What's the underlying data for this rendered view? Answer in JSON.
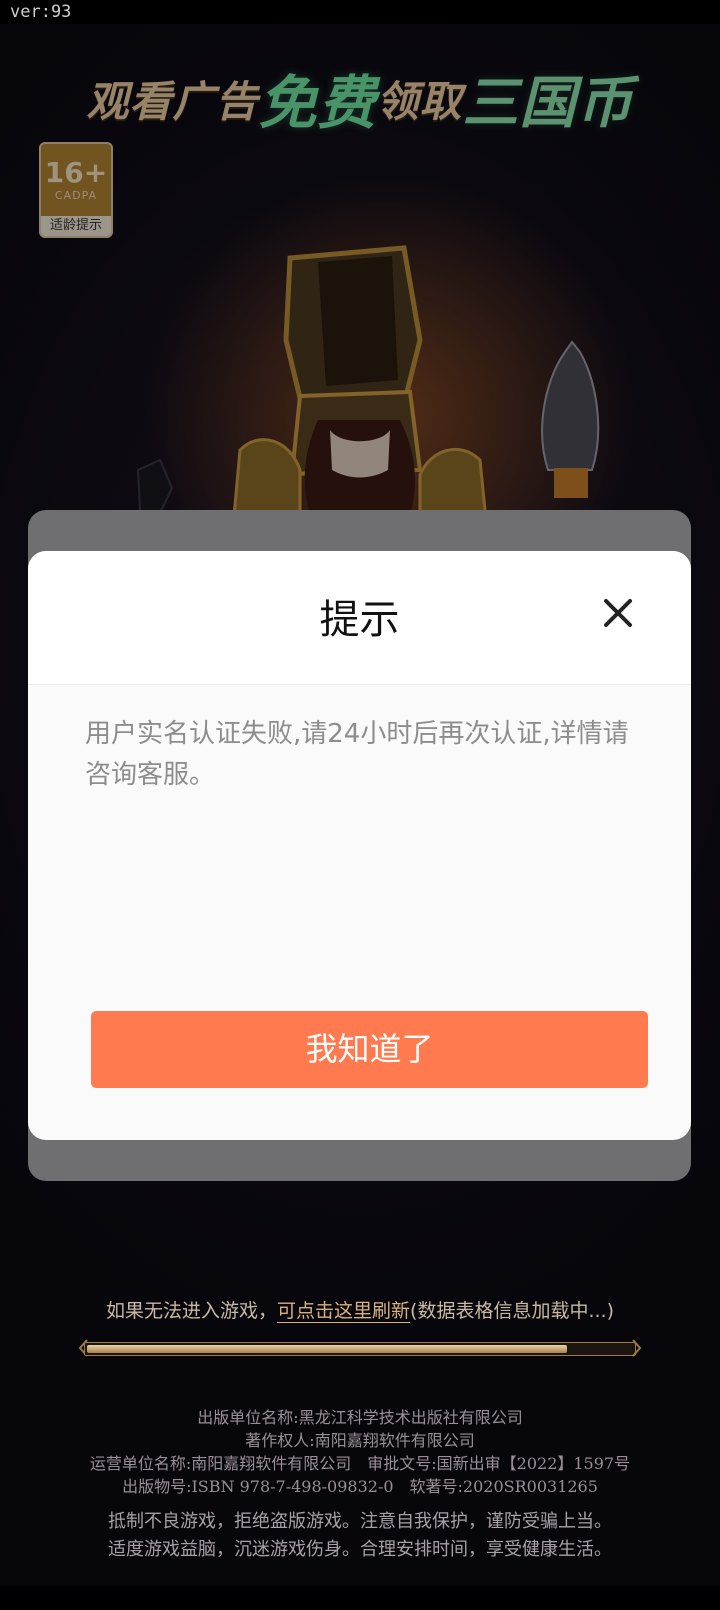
{
  "status_bar": {
    "version": "ver:93"
  },
  "banner": {
    "part1": "观看广告",
    "part2": "免费",
    "part3": "领取",
    "part4": "三国币"
  },
  "age_badge": {
    "number": "16+",
    "org": "CADPA",
    "tip": "适龄提示"
  },
  "dialog": {
    "title": "提示",
    "message": "用户实名认证失败,请24小时后再次认证,详情请咨询客服。",
    "button": "我知道了"
  },
  "refresh": {
    "prefix": "如果无法进入游戏，",
    "link": "可点击这里刷新",
    "status": "(数据表格信息加载中...)"
  },
  "loading": {
    "progress": 0.88
  },
  "legal": {
    "line1": "出版单位名称:黑龙江科学技术出版社有限公司",
    "line2": "著作权人:南阳嘉翔软件有限公司",
    "line3": "运营单位名称:南阳嘉翔软件有限公司　审批文号:国新出审【2022】1597号",
    "line4": "出版物号:ISBN 978-7-498-09832-0　软著号:2020SR0031265",
    "line5": "抵制不良游戏，拒绝盗版游戏。注意自我保护，谨防受骗上当。",
    "line6": "适度游戏益脑，沉迷游戏伤身。合理安排时间，享受健康生活。"
  },
  "colors": {
    "accent": "#ff7a4f",
    "dialog_bg": "#fafafa",
    "link": "#d7b27c"
  }
}
